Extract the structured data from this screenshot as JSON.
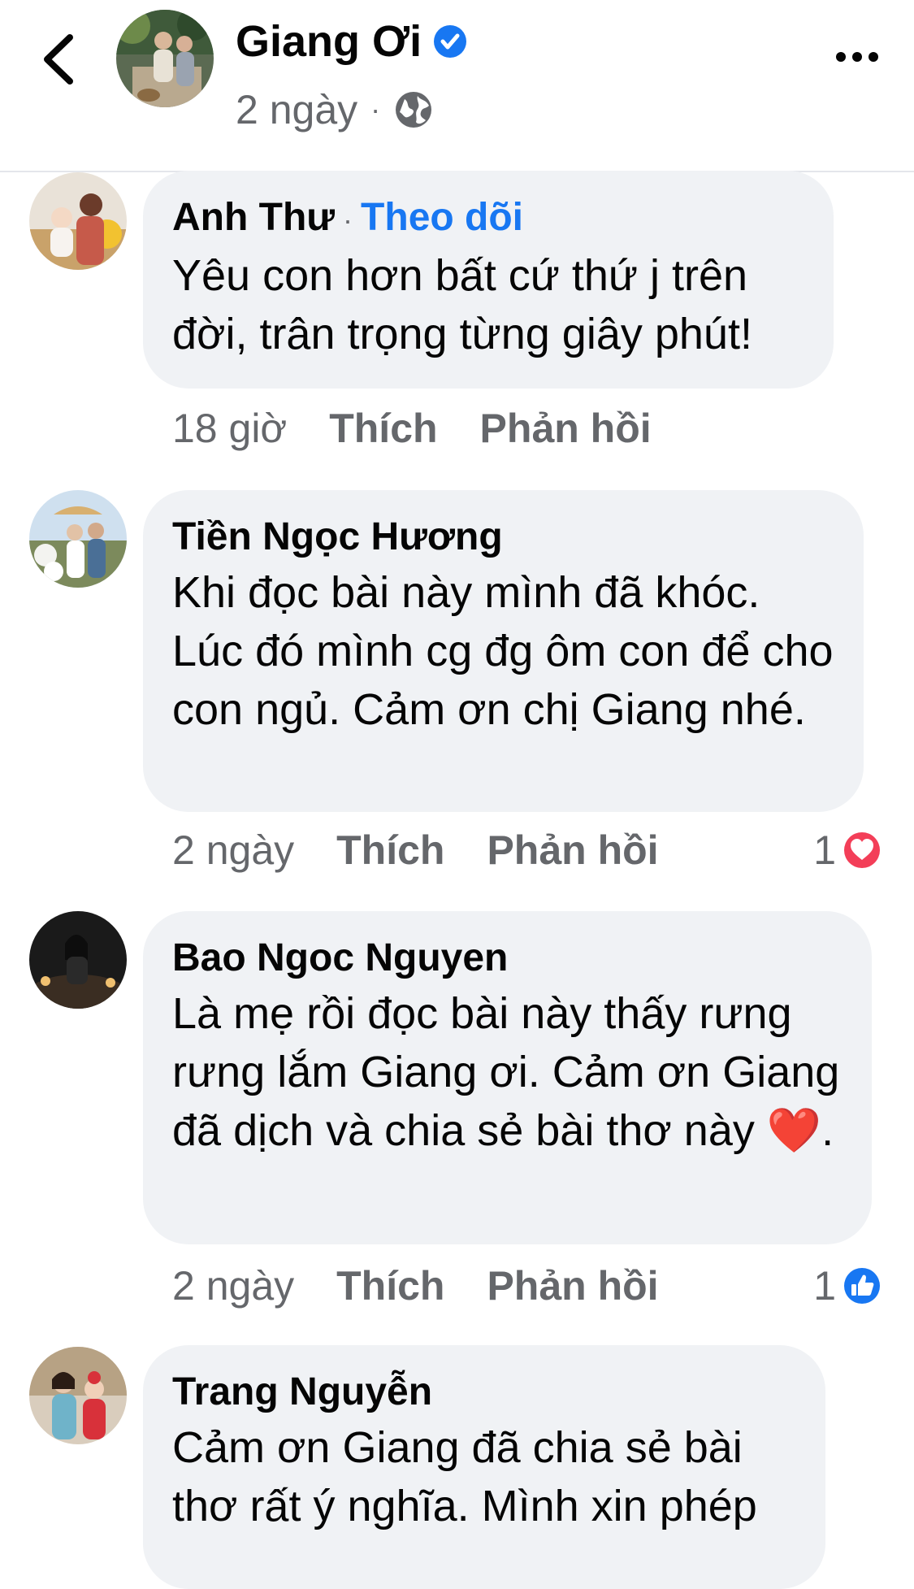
{
  "header": {
    "page_name": "Giang Ơi",
    "time": "2 ngày",
    "separator": "·",
    "icons": {
      "back": "chevron-left-icon",
      "verified": "verified-badge-icon",
      "audience": "globe-icon",
      "more": "more-horizontal-icon"
    }
  },
  "colors": {
    "link": "#1877f2",
    "bubble": "#f0f2f5",
    "meta": "#65676b",
    "heart": "#f33e58",
    "like": "#1877f2"
  },
  "comments": [
    {
      "author": "Anh Thư",
      "separator": "·",
      "follow_label": "Theo dõi",
      "text": "Yêu con hơn bất cứ thứ j trên đời, trân trọng từng giây phút!",
      "time": "18 giờ",
      "like_label": "Thích",
      "reply_label": "Phản hồi"
    },
    {
      "author": "Tiền Ngọc Hương",
      "text": "Khi đọc bài này mình đã khóc. Lúc đó mình cg đg ôm con để cho con ngủ. Cảm ơn chị Giang nhé.",
      "time": "2 ngày",
      "like_label": "Thích",
      "reply_label": "Phản hồi",
      "reaction_count": "1",
      "reaction_icon": "heart-reaction-icon"
    },
    {
      "author": "Bao Ngoc Nguyen",
      "text": "Là mẹ rồi đọc bài này thấy rưng rưng lắm Giang ơi. Cảm ơn Giang đã dịch và chia sẻ bài thơ này ❤️.",
      "time": "2 ngày",
      "like_label": "Thích",
      "reply_label": "Phản hồi",
      "reaction_count": "1",
      "reaction_icon": "like-reaction-icon"
    },
    {
      "author": "Trang Nguyễn",
      "text": "Cảm ơn Giang đã chia sẻ bài thơ rất ý nghĩa. Mình xin phép"
    }
  ]
}
